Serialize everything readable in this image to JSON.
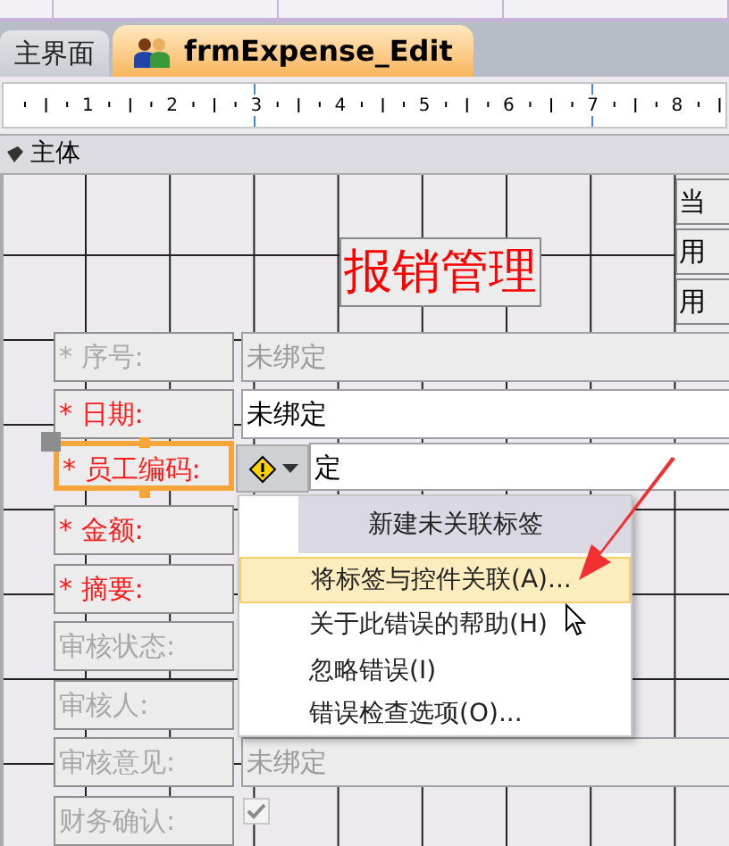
{
  "document_tabs": [
    {
      "label": "主界面",
      "selected": false
    },
    {
      "label": "frmExpense_Edit",
      "selected": true
    }
  ],
  "ruler": {
    "numbers": [
      "1",
      "2",
      "3",
      "4",
      "5",
      "6",
      "7",
      "8"
    ]
  },
  "section": {
    "title": "主体"
  },
  "form_title": "报销管理",
  "side_labels": [
    "当",
    "用",
    "用"
  ],
  "fields": [
    {
      "label": "* 序号:",
      "enabled": false,
      "selected": false,
      "value": "未绑定",
      "value_enabled": false
    },
    {
      "label": "* 日期:",
      "enabled": true,
      "selected": false,
      "value": "未绑定",
      "value_enabled": true
    },
    {
      "label": "* 员工编码:",
      "enabled": true,
      "selected": true,
      "value": "定",
      "value_enabled": true
    },
    {
      "label": "* 金额:",
      "enabled": true,
      "selected": false
    },
    {
      "label": "* 摘要:",
      "enabled": true,
      "selected": false
    },
    {
      "label": "审核状态:",
      "enabled": false,
      "selected": false
    },
    {
      "label": "审核人:",
      "enabled": false,
      "selected": false
    },
    {
      "label": "审核意见:",
      "enabled": false,
      "selected": false,
      "value": "未绑定",
      "value_enabled": false
    },
    {
      "label": "财务确认:",
      "enabled": false,
      "selected": false,
      "kind": "checkbox",
      "checked": true
    }
  ],
  "context_menu": [
    {
      "label": "新建未关联标签",
      "kind": "header",
      "selected": false
    },
    {
      "label": "将标签与控件关联(A)...",
      "kind": "item",
      "selected": true
    },
    {
      "label": "关于此错误的帮助(H)",
      "kind": "item",
      "selected": false
    },
    {
      "label": "忽略错误(I)",
      "kind": "item",
      "selected": false,
      "separator_before": true
    },
    {
      "label": "错误检查选项(O)...",
      "kind": "item",
      "selected": false
    }
  ]
}
